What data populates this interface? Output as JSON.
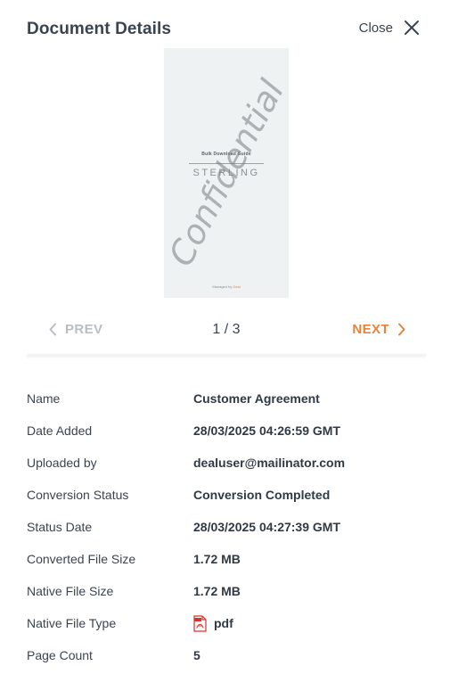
{
  "header": {
    "title": "Document Details",
    "close_label": "Close"
  },
  "preview": {
    "doc_title": "Bulk Download Guide",
    "brand": "STERLING",
    "footer_prefix": "Managed by",
    "footer_accent": "Deal",
    "watermark": "Confidential"
  },
  "pager": {
    "prev_label": "PREV",
    "next_label": "NEXT",
    "count": "1 / 3"
  },
  "details": {
    "rows": [
      {
        "label": "Name",
        "value": "Customer Agreement"
      },
      {
        "label": "Date Added",
        "value": "28/03/2025 04:26:59 GMT"
      },
      {
        "label": "Uploaded by",
        "value": "dealuser@mailinator.com"
      },
      {
        "label": "Conversion Status",
        "value": "Conversion Completed"
      },
      {
        "label": "Status Date",
        "value": "28/03/2025 04:27:39 GMT"
      },
      {
        "label": "Converted File Size",
        "value": "1.72 MB"
      },
      {
        "label": "Native File Size",
        "value": "1.72 MB"
      },
      {
        "label": "Native File Type",
        "value": "pdf",
        "icon": "pdf-file-icon"
      },
      {
        "label": "Page Count",
        "value": "5"
      }
    ]
  },
  "colors": {
    "accent": "#e8833a",
    "disabled": "#b8bec4",
    "text": "#3a4450"
  }
}
